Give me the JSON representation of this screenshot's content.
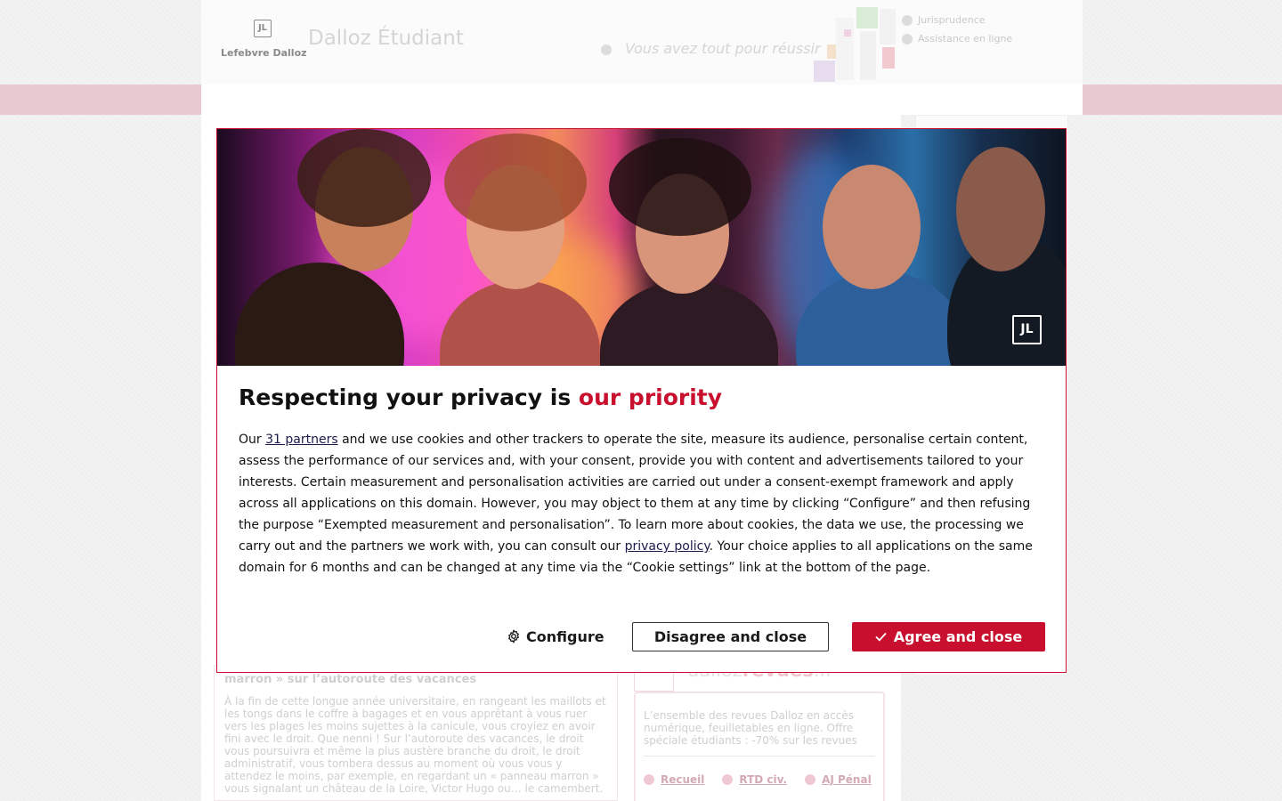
{
  "site": {
    "brand_mark": "JL",
    "brand_name": "Lefebvre Dalloz",
    "title": "Dalloz Étudiant",
    "tagline": "Vous avez tout pour réussir",
    "header_links": [
      "Jurisprudence",
      "Assistance en ligne"
    ]
  },
  "article": {
    "title": "marron » sur l’autoroute des vacances",
    "body": "À la fin de cette longue année universitaire, en rangeant les maillots et les tongs dans le coffre à bagages et en vous apprêtant à vous ruer vers les plages les moins sujettes à la canicule, vous croyiez en avoir fini avec le droit. Que nenni ! Sur l’autoroute des vacances, le droit vous poursuivra et même la plus austère branche du droit, le droit administratif, vous tombera dessus au moment où vous vous y attendez le moins, par exemple, en regardant un « panneau marron » vous signalant un château de la Loire, Victor Hugo ou… le camembert."
  },
  "revues": {
    "logo_prefix": "dalloz",
    "logo_emphasis": "revues",
    "logo_suffix": ".fr",
    "description": "L’ensemble des revues Dalloz en accès numérique, feuilletables en ligne. Offre spéciale étudiants : -70% sur les revues",
    "links": [
      "Recueil",
      "RTD civ.",
      "AJ Pénal"
    ]
  },
  "modal": {
    "hero_logo": "JL",
    "title_prefix": "Respecting your privacy is ",
    "title_accent": "our priority",
    "text_1": "Our ",
    "partners_link": "31 partners",
    "text_2": " and we use cookies and other trackers to operate the site, measure its audience, personalise certain content, assess the performance of our services and, with your consent, provide you with content and advertisements tailored to your interests. Certain measurement and personalisation activities are carried out under a consent-exempt framework and apply across all applications on this domain. However, you may object to them at any time by clicking “Configure” and then refusing the purpose “Exempted measurement and personalisation”. To learn more about cookies, the data we use, the processing we carry out and the partners we work with, you can consult our ",
    "privacy_link": "privacy policy",
    "text_3": ". Your choice applies to all applications on the same domain for 6 months and can be changed at any time via the “Cookie settings” link at the bottom of the page.",
    "configure_label": "Configure",
    "disagree_label": "Disagree and close",
    "agree_label": "Agree and close"
  },
  "colors": {
    "accent": "#c8102e",
    "pink_band": "#e9c9d1"
  },
  "icons": {
    "configure": "gear-icon",
    "agree": "check-icon",
    "brand": "lefebvre-dalloz-logo"
  }
}
